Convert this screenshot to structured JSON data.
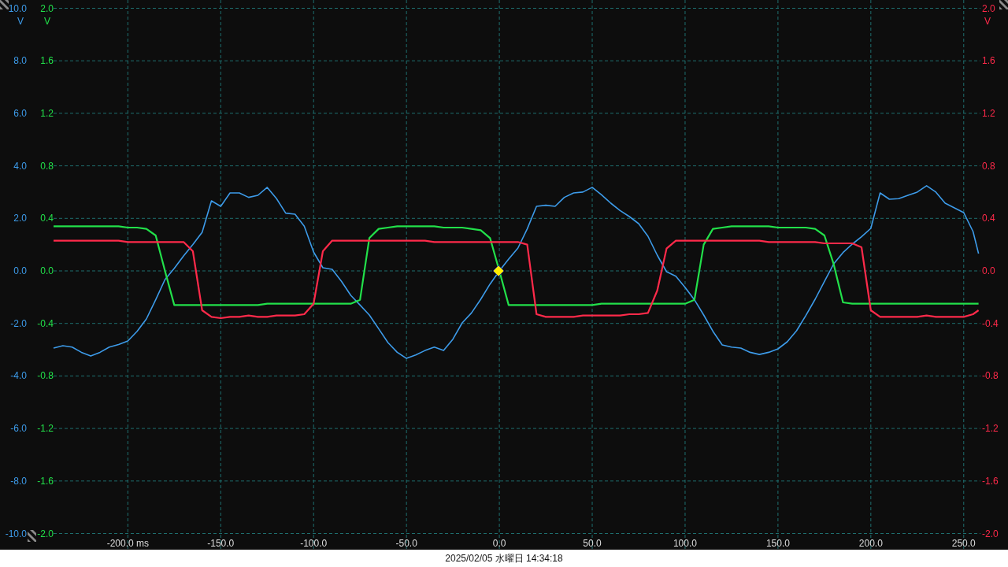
{
  "y_axes": [
    {
      "color": "#3d9be9",
      "unit": "V"
    },
    {
      "color": "#22e04a",
      "unit": "V"
    },
    {
      "color": "#ff2a4a",
      "unit": "V"
    }
  ],
  "chart_data": {
    "type": "line",
    "grid": true,
    "xlim": [
      -240,
      259
    ],
    "ylim": [
      -10,
      10
    ],
    "y2lim": [
      -2,
      2
    ],
    "y3lim": [
      -2,
      2
    ],
    "xticks": [
      {
        "value": -200,
        "label": "-200.0 ms"
      },
      {
        "value": -150,
        "label": "-150.0"
      },
      {
        "value": -100,
        "label": "-100.0"
      },
      {
        "value": -50,
        "label": "-50.0"
      },
      {
        "value": 0,
        "label": "0.0"
      },
      {
        "value": 50,
        "label": "50.0"
      },
      {
        "value": 100,
        "label": "100.0"
      },
      {
        "value": 150,
        "label": "150.0"
      },
      {
        "value": 200,
        "label": "200.0"
      },
      {
        "value": 250,
        "label": "250.0"
      }
    ],
    "yticks": [
      {
        "value": 10,
        "label": "10.0"
      },
      {
        "value": 8,
        "label": "8.0"
      },
      {
        "value": 6,
        "label": "6.0"
      },
      {
        "value": 4,
        "label": "4.0"
      },
      {
        "value": 2,
        "label": "2.0"
      },
      {
        "value": 0,
        "label": "0.0"
      },
      {
        "value": -2,
        "label": "-2.0"
      },
      {
        "value": -4,
        "label": "-4.0"
      },
      {
        "value": -6,
        "label": "-6.0"
      },
      {
        "value": -8,
        "label": "-8.0"
      },
      {
        "value": -10,
        "label": "-10.0"
      }
    ],
    "y2ticks": [
      {
        "value": 2,
        "label": "2.0"
      },
      {
        "value": 1.6,
        "label": "1.6"
      },
      {
        "value": 1.2,
        "label": "1.2"
      },
      {
        "value": 0.8,
        "label": "0.8"
      },
      {
        "value": 0.4,
        "label": "0.4"
      },
      {
        "value": 0,
        "label": "0.0"
      },
      {
        "value": -0.4,
        "label": "-0.4"
      },
      {
        "value": -0.8,
        "label": "-0.8"
      },
      {
        "value": -1.2,
        "label": "-1.2"
      },
      {
        "value": -1.6,
        "label": "-1.6"
      },
      {
        "value": -2,
        "label": "-2.0"
      }
    ],
    "y3ticks": [
      {
        "value": 2,
        "label": "2.0"
      },
      {
        "value": 1.6,
        "label": "1.6"
      },
      {
        "value": 1.2,
        "label": "1.2"
      },
      {
        "value": 0.8,
        "label": "0.8"
      },
      {
        "value": 0.4,
        "label": "0.4"
      },
      {
        "value": 0,
        "label": "0.0"
      },
      {
        "value": -0.4,
        "label": "-0.4"
      },
      {
        "value": -0.8,
        "label": "-0.8"
      },
      {
        "value": -1.2,
        "label": "-1.2"
      },
      {
        "value": -1.6,
        "label": "-1.6"
      },
      {
        "value": -2,
        "label": "-2.0"
      }
    ],
    "x": [
      -240,
      -235,
      -230,
      -225,
      -220,
      -215,
      -210,
      -205,
      -200,
      -195,
      -190,
      -185,
      -180,
      -175,
      -170,
      -165,
      -160,
      -155,
      -150,
      -145,
      -140,
      -135,
      -130,
      -125,
      -120,
      -115,
      -110,
      -105,
      -100,
      -95,
      -90,
      -85,
      -80,
      -75,
      -70,
      -65,
      -60,
      -55,
      -50,
      -45,
      -40,
      -35,
      -30,
      -25,
      -20,
      -15,
      -10,
      -5,
      0,
      5,
      10,
      15,
      20,
      25,
      30,
      35,
      40,
      45,
      50,
      55,
      60,
      65,
      70,
      75,
      80,
      85,
      90,
      95,
      100,
      105,
      110,
      115,
      120,
      125,
      130,
      135,
      140,
      145,
      150,
      155,
      160,
      165,
      170,
      175,
      180,
      185,
      190,
      195,
      200,
      205,
      210,
      215,
      220,
      225,
      230,
      235,
      240,
      245,
      250,
      255,
      258
    ],
    "series": [
      {
        "color": "#3d9be9",
        "axis": "y",
        "values": [
          -2.94,
          -2.85,
          -2.9,
          -3.1,
          -3.24,
          -3.1,
          -2.9,
          -2.8,
          -2.67,
          -2.3,
          -1.83,
          -1.1,
          -0.33,
          0.1,
          0.57,
          1.0,
          1.47,
          2.67,
          2.46,
          2.97,
          2.97,
          2.8,
          2.88,
          3.18,
          2.76,
          2.2,
          2.16,
          1.7,
          0.72,
          0.12,
          0.06,
          -0.4,
          -0.93,
          -1.3,
          -1.68,
          -2.2,
          -2.73,
          -3.1,
          -3.33,
          -3.2,
          -3.03,
          -2.9,
          -3.03,
          -2.6,
          -1.98,
          -1.6,
          -1.08,
          -0.5,
          0.0,
          0.45,
          0.87,
          1.6,
          2.46,
          2.5,
          2.46,
          2.8,
          2.97,
          3.0,
          3.18,
          2.9,
          2.58,
          2.3,
          2.07,
          1.8,
          1.32,
          0.6,
          -0.03,
          -0.2,
          -0.63,
          -1.1,
          -1.68,
          -2.3,
          -2.82,
          -2.9,
          -2.94,
          -3.1,
          -3.18,
          -3.1,
          -2.97,
          -2.7,
          -2.28,
          -1.7,
          -1.08,
          -0.4,
          0.27,
          0.7,
          1.02,
          1.3,
          1.62,
          2.97,
          2.73,
          2.75,
          2.88,
          3.0,
          3.24,
          3.0,
          2.58,
          2.4,
          2.22,
          1.5,
          0.66
        ]
      },
      {
        "color": "#22e04a",
        "axis": "y2",
        "values": [
          0.34,
          0.34,
          0.34,
          0.34,
          0.34,
          0.34,
          0.34,
          0.34,
          0.33,
          0.33,
          0.32,
          0.27,
          0.0,
          -0.26,
          -0.26,
          -0.26,
          -0.26,
          -0.26,
          -0.26,
          -0.26,
          -0.26,
          -0.26,
          -0.26,
          -0.25,
          -0.25,
          -0.25,
          -0.25,
          -0.25,
          -0.25,
          -0.25,
          -0.25,
          -0.25,
          -0.25,
          -0.22,
          0.25,
          0.32,
          0.33,
          0.34,
          0.34,
          0.34,
          0.34,
          0.34,
          0.33,
          0.33,
          0.33,
          0.32,
          0.31,
          0.25,
          0.0,
          -0.26,
          -0.26,
          -0.26,
          -0.26,
          -0.26,
          -0.26,
          -0.26,
          -0.26,
          -0.26,
          -0.26,
          -0.25,
          -0.25,
          -0.25,
          -0.25,
          -0.25,
          -0.25,
          -0.25,
          -0.25,
          -0.25,
          -0.25,
          -0.22,
          0.2,
          0.32,
          0.33,
          0.34,
          0.34,
          0.34,
          0.34,
          0.34,
          0.33,
          0.33,
          0.33,
          0.33,
          0.32,
          0.27,
          0.05,
          -0.24,
          -0.25,
          -0.25,
          -0.25,
          -0.25,
          -0.25,
          -0.25,
          -0.25,
          -0.25,
          -0.25,
          -0.25,
          -0.25,
          -0.25,
          -0.25,
          -0.25,
          -0.25
        ]
      },
      {
        "color": "#ff2a4a",
        "axis": "y3",
        "values": [
          0.23,
          0.23,
          0.23,
          0.23,
          0.23,
          0.23,
          0.23,
          0.23,
          0.22,
          0.22,
          0.22,
          0.22,
          0.22,
          0.22,
          0.22,
          0.15,
          -0.3,
          -0.35,
          -0.36,
          -0.35,
          -0.35,
          -0.34,
          -0.35,
          -0.35,
          -0.34,
          -0.34,
          -0.34,
          -0.33,
          -0.25,
          0.15,
          0.23,
          0.23,
          0.23,
          0.23,
          0.23,
          0.23,
          0.23,
          0.23,
          0.23,
          0.23,
          0.23,
          0.22,
          0.22,
          0.22,
          0.22,
          0.22,
          0.22,
          0.22,
          0.22,
          0.22,
          0.22,
          0.2,
          -0.33,
          -0.35,
          -0.35,
          -0.35,
          -0.35,
          -0.34,
          -0.34,
          -0.34,
          -0.34,
          -0.34,
          -0.33,
          -0.33,
          -0.32,
          -0.15,
          0.17,
          0.23,
          0.23,
          0.23,
          0.23,
          0.23,
          0.23,
          0.23,
          0.23,
          0.23,
          0.23,
          0.22,
          0.22,
          0.22,
          0.22,
          0.22,
          0.22,
          0.21,
          0.21,
          0.21,
          0.21,
          0.18,
          -0.3,
          -0.35,
          -0.35,
          -0.35,
          -0.35,
          -0.35,
          -0.34,
          -0.35,
          -0.35,
          -0.35,
          -0.35,
          -0.33,
          -0.3
        ]
      }
    ]
  },
  "status_bar": {
    "datetime": "2025/02/05 水曜日 14:34:18"
  }
}
